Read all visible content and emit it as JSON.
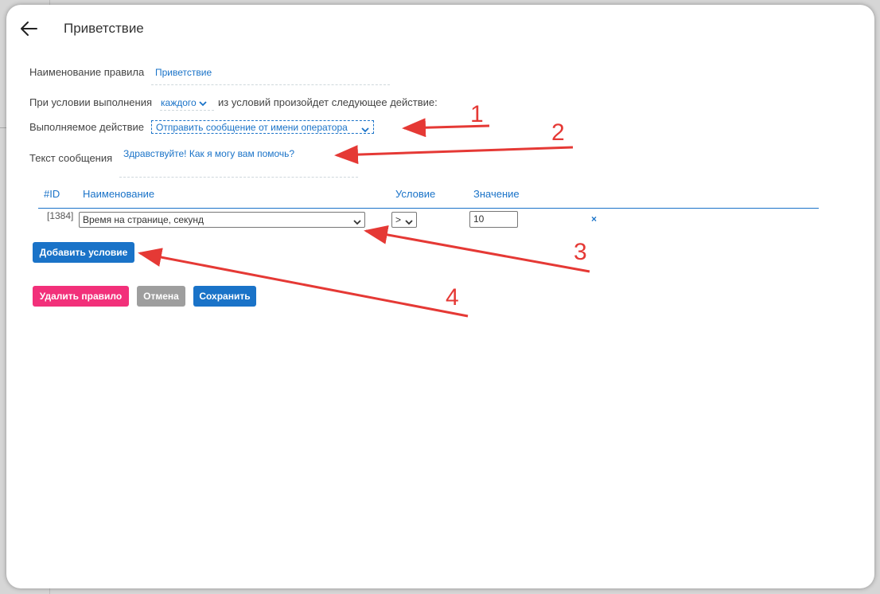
{
  "header": {
    "title": "Приветствие"
  },
  "form": {
    "rule_name_label": "Наименование правила",
    "rule_name_value": "Приветствие",
    "condition_prefix": "При условии выполнения",
    "condition_mode": "каждого",
    "condition_suffix": "из условий произойдет следующее действие:",
    "action_label": "Выполняемое действие",
    "action_value": "Отправить сообщение от имени оператора",
    "message_label": "Текст сообщения",
    "message_value": "Здравствуйте! Как я могу вам помочь?"
  },
  "table": {
    "headers": {
      "id": "#ID",
      "name": "Наименование",
      "condition": "Условие",
      "value": "Значение"
    },
    "rows": [
      {
        "id": "[1384]",
        "name": "Время на странице, секунд",
        "operator": ">",
        "value": "10",
        "remove": "×"
      }
    ]
  },
  "buttons": {
    "add_condition": "Добавить условие",
    "delete_rule": "Удалить правило",
    "cancel": "Отмена",
    "save": "Сохранить"
  },
  "annotations": [
    "1",
    "2",
    "3",
    "4"
  ],
  "colors": {
    "accent": "#1a73c8",
    "delete": "#f2307a",
    "cancel": "#9e9e9e",
    "arrow": "#e53935"
  }
}
